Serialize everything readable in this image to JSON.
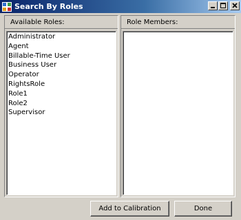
{
  "window": {
    "title": "Search By Roles"
  },
  "available_roles": {
    "header": "Available Roles:",
    "items": [
      "Administrator",
      "Agent",
      "Billable-Time User",
      "Business User",
      "Operator",
      "RightsRole",
      "Role1",
      "Role2",
      "Supervisor"
    ]
  },
  "role_members": {
    "header": "Role Members:",
    "items": []
  },
  "buttons": {
    "add_to_calibration": "Add to Calibration",
    "done": "Done"
  }
}
